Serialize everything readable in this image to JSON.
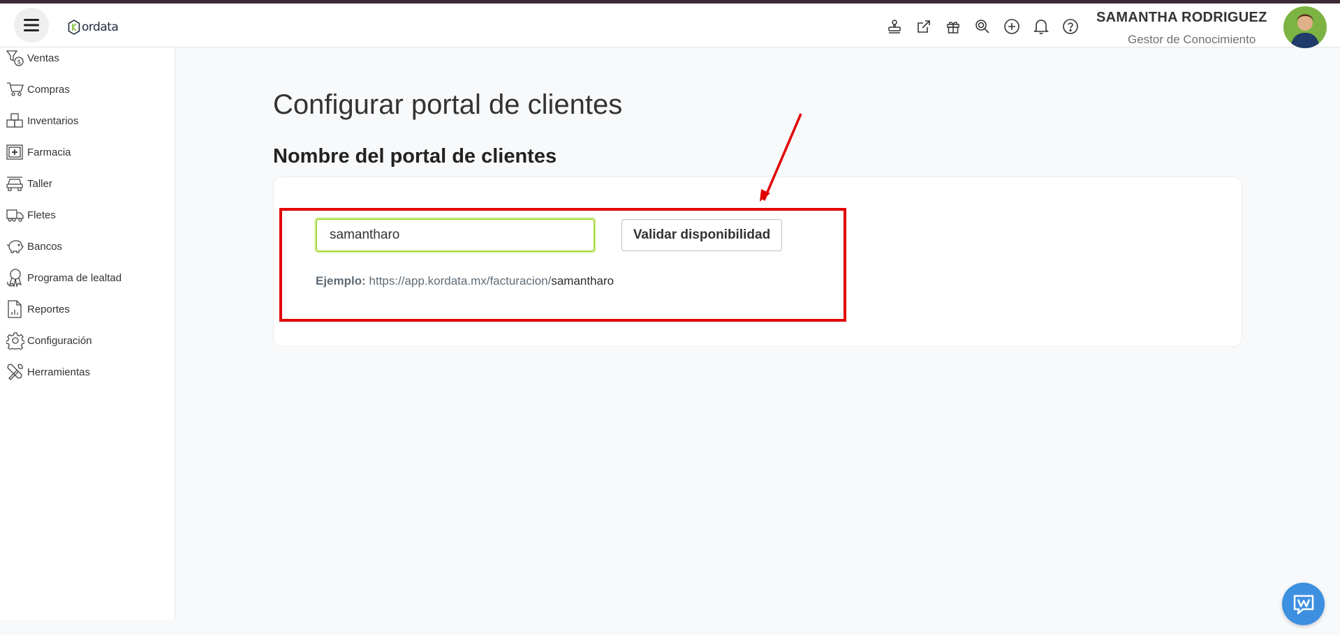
{
  "app": {
    "logo_text": "ordata"
  },
  "header": {
    "icons": [
      "stamp-icon",
      "external-link-icon",
      "gift-icon",
      "search-zoom-icon",
      "add-circle-icon",
      "bell-icon",
      "help-icon"
    ],
    "user_name": "SAMANTHA RODRIGUEZ",
    "user_role": "Gestor de Conocimiento"
  },
  "sidebar": {
    "items": [
      {
        "label": "Ventas",
        "icon": "sales-icon"
      },
      {
        "label": "Compras",
        "icon": "cart-icon"
      },
      {
        "label": "Inventarios",
        "icon": "boxes-icon"
      },
      {
        "label": "Farmacia",
        "icon": "pharmacy-icon"
      },
      {
        "label": "Taller",
        "icon": "car-icon"
      },
      {
        "label": "Fletes",
        "icon": "truck-icon"
      },
      {
        "label": "Bancos",
        "icon": "piggy-bank-icon"
      },
      {
        "label": "Programa de lealtad",
        "icon": "loyalty-icon"
      },
      {
        "label": "Reportes",
        "icon": "report-icon"
      },
      {
        "label": "Configuración",
        "icon": "gear-icon"
      },
      {
        "label": "Herramientas",
        "icon": "tools-icon"
      }
    ]
  },
  "main": {
    "page_title": "Configurar portal de clientes",
    "section_title": "Nombre del portal de clientes",
    "portal_input_value": "samantharo",
    "validate_label": "Validar disponibilidad",
    "example_label": "Ejemplo:",
    "example_url": "https://app.kordata.mx/facturacion/",
    "example_user": "samantharo"
  },
  "colors": {
    "annotation_red": "#e10000",
    "input_focus": "#a5d93a",
    "chat_blue": "#3d8fe0"
  }
}
